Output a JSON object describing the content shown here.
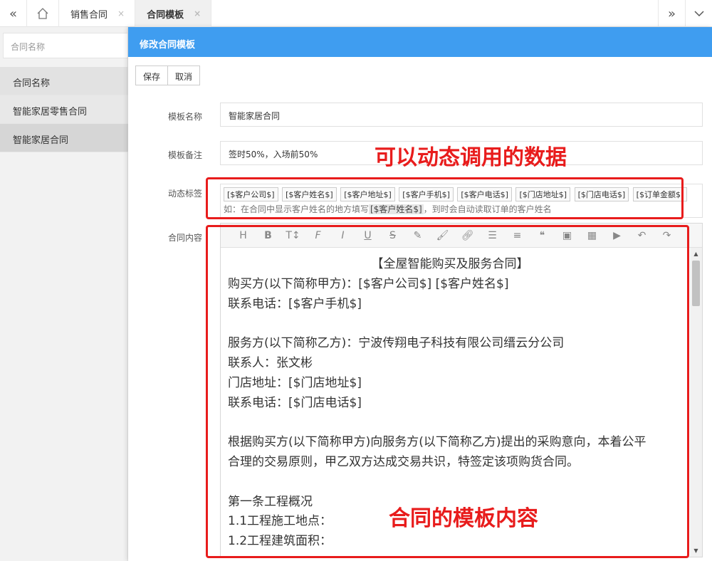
{
  "tabs": [
    {
      "label": "销售合同",
      "close": "×",
      "active": false
    },
    {
      "label": "合同模板",
      "close": "×",
      "active": true
    }
  ],
  "left": {
    "search_placeholder": "合同名称",
    "header": "合同名称",
    "items": [
      "智能家居零售合同",
      "智能家居合同"
    ]
  },
  "dialog": {
    "title": "修改合同模板",
    "save": "保存",
    "cancel": "取消",
    "name_label": "模板名称",
    "name_value": "智能家居合同",
    "remark_label": "模板备注",
    "remark_value": "签时50%，入场前50%",
    "tags_label": "动态标签",
    "tags": [
      "[$客户公司$]",
      "[$客户姓名$]",
      "[$客户地址$]",
      "[$客户手机$]",
      "[$客户电话$]",
      "[$门店地址$]",
      "[$门店电话$]",
      "[$订单金额$]"
    ],
    "hint_prefix": "如：在合同中显示客户姓名的地方填写",
    "hint_tag": "[$客户姓名$]",
    "hint_suffix": "，到时会自动读取订单的客户姓名",
    "content_label": "合同内容"
  },
  "editor": {
    "lines": [
      "【全屋智能购买及服务合同】",
      "购买方(以下简称甲方)：[$客户公司$] [$客户姓名$]",
      "联系电话：[$客户手机$]",
      "",
      "服务方(以下简称乙方)：宁波传翔电子科技有限公司缙云分公司",
      "联系人：张文彬",
      "门店地址：[$门店地址$]",
      "联系电话：[$门店电话$]",
      "",
      "根据购买方(以下简称甲方)向服务方(以下简称乙方)提出的采购意向，本着公平",
      "合理的交易原则，甲乙双方达成交易共识，特签定该项购货合同。",
      "",
      "第一条工程概况",
      "1.1工程施工地点：",
      "1.2工程建筑面积："
    ]
  },
  "annotations": {
    "dynamic": "可以动态调用的数据",
    "template": "合同的模板内容"
  },
  "colors": {
    "accent": "#3f9df0",
    "annotation": "#e81c1c"
  }
}
